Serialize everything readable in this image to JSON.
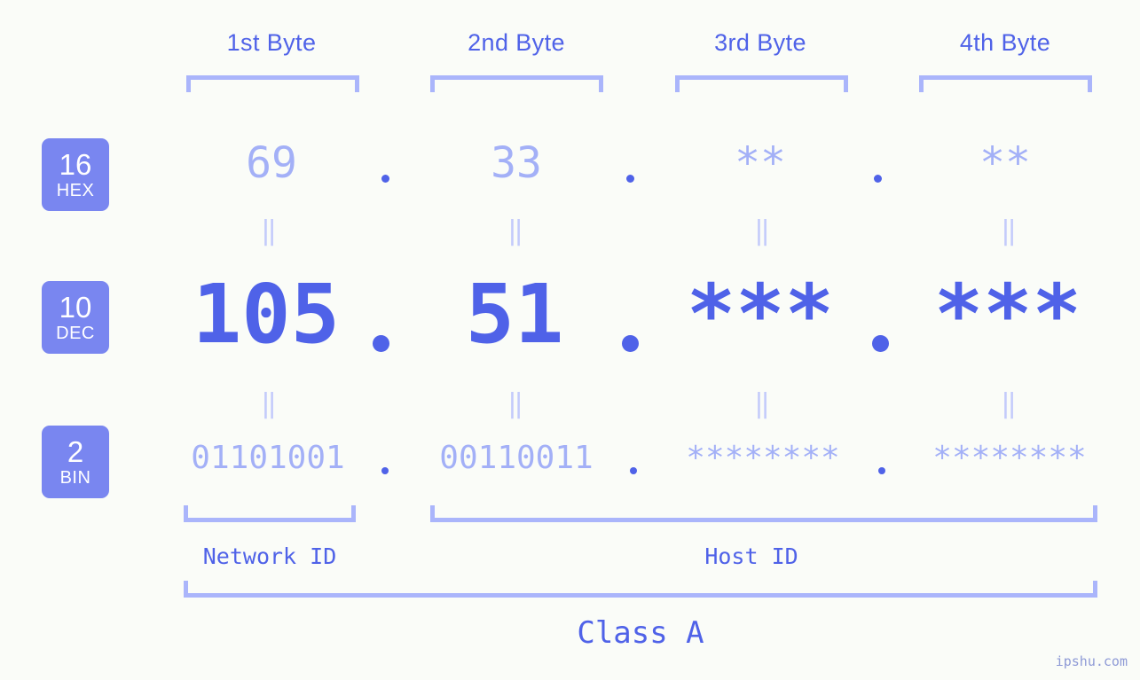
{
  "page": {
    "watermark": "ipshu.com",
    "background_color": "#fafcf8",
    "accent_dark": "#4f62e8",
    "accent_light": "#a3b0f7",
    "bracket_color": "#aab5fb",
    "badge_color": "#7986f0"
  },
  "byte_headers": [
    {
      "label": "1st Byte"
    },
    {
      "label": "2nd Byte"
    },
    {
      "label": "3rd Byte"
    },
    {
      "label": "4th Byte"
    }
  ],
  "rows": [
    {
      "badge_num": "16",
      "badge_name": "HEX",
      "values": [
        "69",
        "33",
        "**",
        "**"
      ],
      "separator": "."
    },
    {
      "badge_num": "10",
      "badge_name": "DEC",
      "values": [
        "105",
        "51",
        "***",
        "***"
      ],
      "separator": "."
    },
    {
      "badge_num": "2",
      "badge_name": "BIN",
      "values": [
        "01101001",
        "00110011",
        "********",
        "********"
      ],
      "separator": "."
    }
  ],
  "equal_marks": {
    "glyph": "‖"
  },
  "segments": [
    {
      "label": "Network ID"
    },
    {
      "label": "Host ID"
    }
  ],
  "class": {
    "label": "Class A"
  }
}
